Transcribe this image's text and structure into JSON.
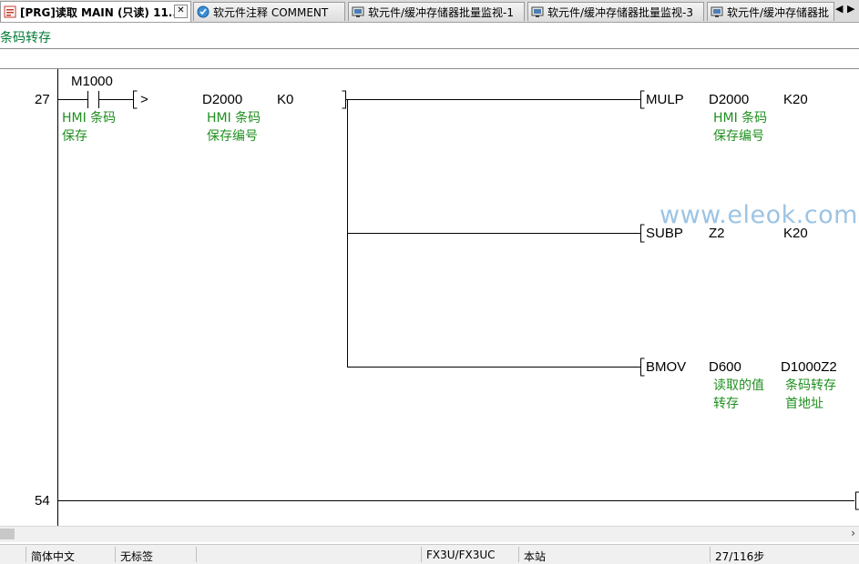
{
  "tabs": [
    {
      "label": "[PRG]读取 MAIN (只读) 11...",
      "icon": "program-icon",
      "active": true
    },
    {
      "label": "软元件注释 COMMENT",
      "icon": "comment-icon"
    },
    {
      "label": "软元件/缓冲存储器批量监视-1",
      "icon": "monitor-icon"
    },
    {
      "label": "软元件/缓冲存储器批量监视-3",
      "icon": "monitor-icon"
    },
    {
      "label": "软元件/缓冲存储器批",
      "icon": "monitor-icon"
    }
  ],
  "tab_close_symbol": "✕",
  "tab_nav": {
    "left": "◀",
    "right": "▶"
  },
  "statement_comment": "条码转存",
  "ladder": {
    "rung1": {
      "step": "27",
      "contact": {
        "device": "M1000",
        "comment": [
          "HMI 条码",
          "保存"
        ]
      },
      "compare": {
        "op": ">",
        "s1": "D2000",
        "s2": "K0",
        "s1_comment": [
          "HMI 条码",
          "保存编号"
        ]
      },
      "branches": [
        {
          "instr": "MULP",
          "op1": "D2000",
          "op2": "K20",
          "op1_comment": [
            "HMI 条码",
            "保存编号"
          ]
        },
        {
          "instr": "SUBP",
          "op1": "Z2",
          "op2": "K20"
        },
        {
          "instr": "BMOV",
          "op1": "D600",
          "op2": "D1000Z2",
          "op1_comment": [
            "读取的值",
            "转存"
          ],
          "op2_comment": [
            "条码转存",
            "首地址"
          ]
        }
      ]
    },
    "rung2": {
      "step": "54"
    }
  },
  "watermark": "www.eleok.com",
  "scrollbar_arrow": "›",
  "status": {
    "language": "简体中文",
    "label": "无标签",
    "cpu": "FX3U/FX3UC",
    "station": "本站",
    "step": "27/116步"
  },
  "colors": {
    "comment_green": "#1f8f1f",
    "statement_green": "#007a33",
    "watermark": "#9cc4e4",
    "ladder_line": "#000000"
  }
}
